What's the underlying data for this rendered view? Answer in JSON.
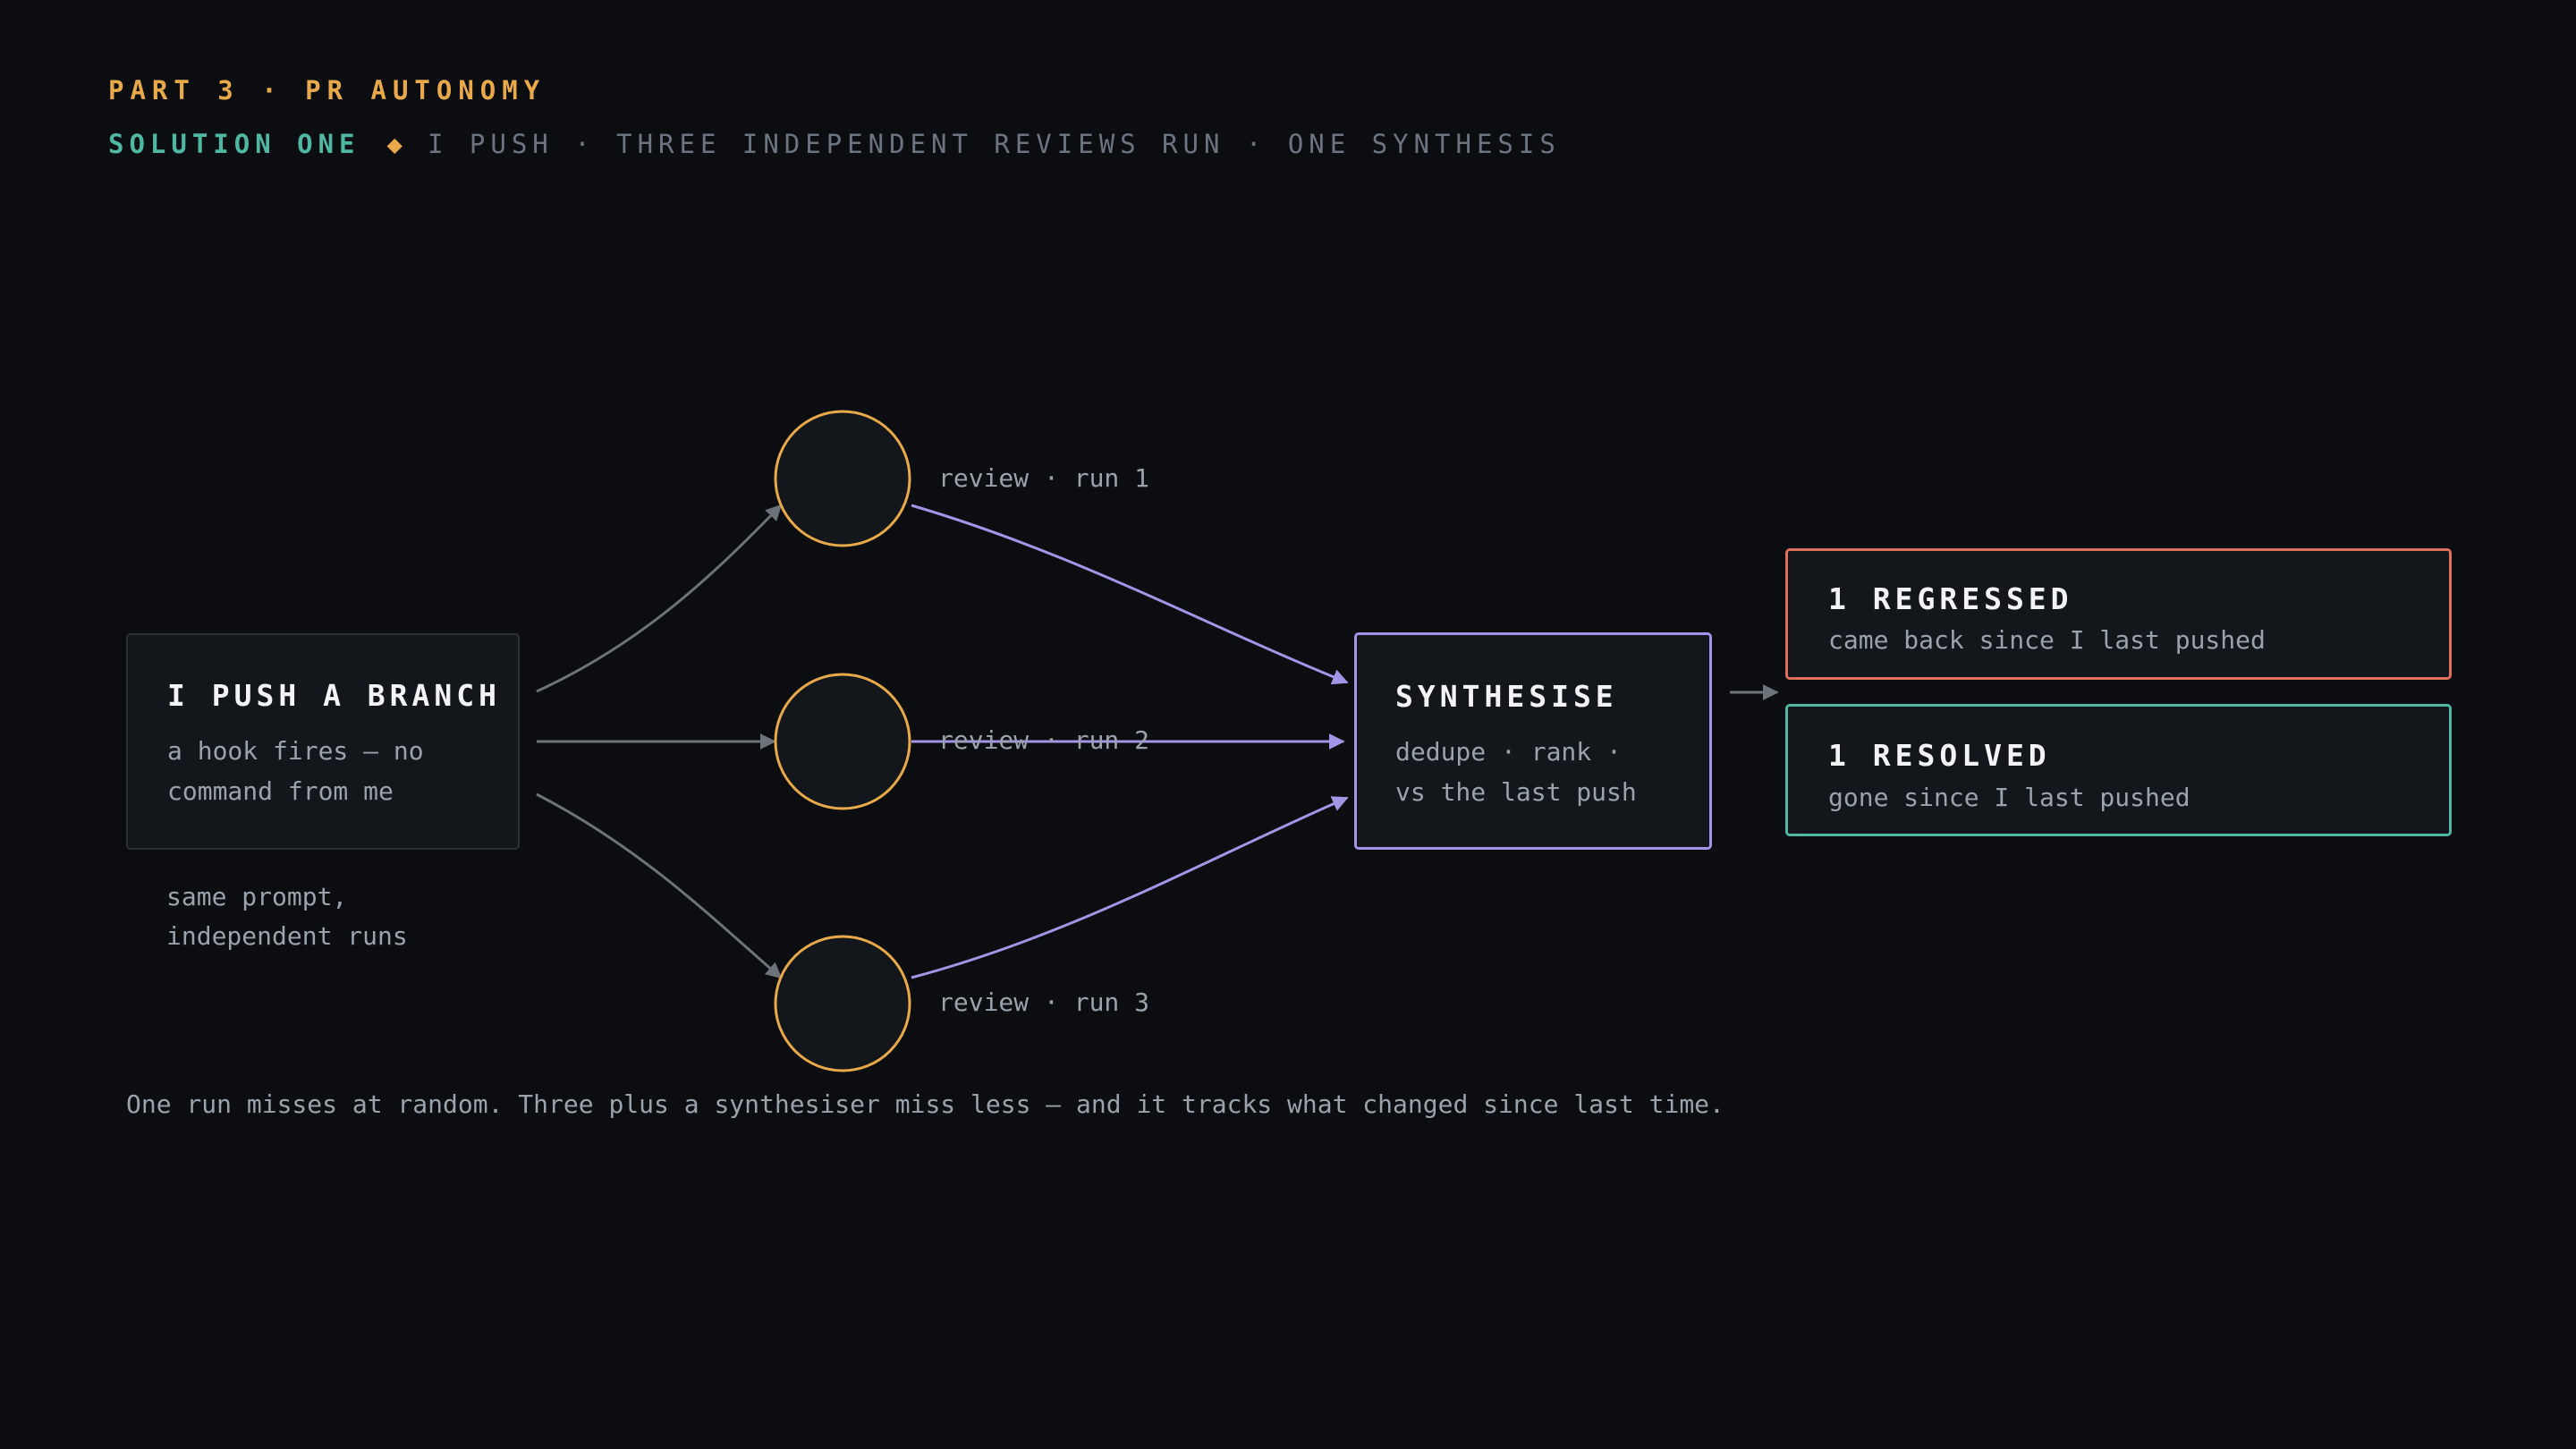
{
  "header": {
    "part": "PART 3 · PR AUTONOMY",
    "solution": "SOLUTION ONE",
    "diamond": "◆",
    "subtitle": "I PUSH · THREE INDEPENDENT REVIEWS RUN · ONE SYNTHESIS"
  },
  "push_box": {
    "title": "I PUSH A BRANCH",
    "body": "a hook fires — no\ncommand from me"
  },
  "push_note": "same prompt,\nindependent runs",
  "reviews": [
    {
      "label": "review · run 1"
    },
    {
      "label": "review · run 2"
    },
    {
      "label": "review · run 3"
    }
  ],
  "synth_box": {
    "title": "SYNTHESISE",
    "body": "dedupe · rank ·\nvs the last push"
  },
  "outcomes": {
    "regressed": {
      "title": "1 REGRESSED",
      "body": "came back since I last pushed"
    },
    "resolved": {
      "title": "1 RESOLVED",
      "body": "gone since I last pushed"
    }
  },
  "caption": "One run misses at random. Three plus a synthesiser miss less — and it tracks what changed since last time.",
  "colors": {
    "background": "#0b0d10",
    "accent_orange": "#e8a94a",
    "accent_teal": "#4fb8a3",
    "accent_purple": "#a394e6",
    "regressed_red": "#e0705c",
    "arrow_gray": "#6c7379"
  }
}
